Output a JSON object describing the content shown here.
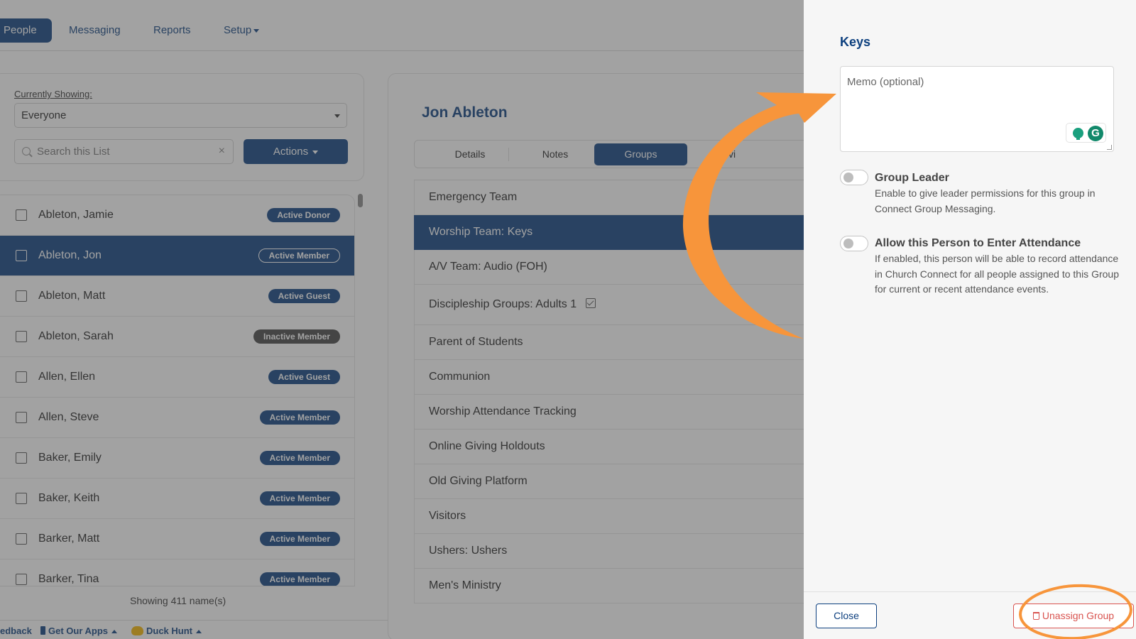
{
  "nav": {
    "people": "People",
    "messaging": "Messaging",
    "reports": "Reports",
    "setup": "Setup"
  },
  "filter": {
    "label": "Currently Showing:",
    "selected": "Everyone",
    "search_placeholder": "Search this List",
    "actions_label": "Actions"
  },
  "people": [
    {
      "name": "Ableton, Jamie",
      "status": "Active Donor"
    },
    {
      "name": "Ableton, Jon",
      "status": "Active Member"
    },
    {
      "name": "Ableton, Matt",
      "status": "Active Guest"
    },
    {
      "name": "Ableton, Sarah",
      "status": "Inactive Member"
    },
    {
      "name": "Allen, Ellen",
      "status": "Active Guest"
    },
    {
      "name": "Allen, Steve",
      "status": "Active Member"
    },
    {
      "name": "Baker, Emily",
      "status": "Active Member"
    },
    {
      "name": "Baker, Keith",
      "status": "Active Member"
    },
    {
      "name": "Barker, Matt",
      "status": "Active Member"
    },
    {
      "name": "Barker, Tina",
      "status": "Active Member"
    }
  ],
  "showing_text": "Showing 411 name(s)",
  "bottom_bar": {
    "feedback": "edback",
    "apps": "Get Our Apps",
    "duck": "Duck Hunt"
  },
  "detail": {
    "person_name": "Jon Ableton",
    "tabs": {
      "details": "Details",
      "notes": "Notes",
      "groups": "Groups",
      "giving": "Givi"
    },
    "groups": [
      "Emergency Team",
      "Worship Team: Keys",
      "A/V Team: Audio (FOH)",
      "Discipleship Groups: Adults 1",
      "Parent of Students",
      "Communion",
      "Worship Attendance Tracking",
      "Online Giving Holdouts",
      "Old Giving Platform",
      "Visitors",
      "Ushers: Ushers",
      "Men's Ministry"
    ]
  },
  "drawer": {
    "title": "Keys",
    "memo_placeholder": "Memo (optional)",
    "grammarly_letter": "G",
    "group_leader": {
      "title": "Group Leader",
      "description": "Enable to give leader permissions for this group in Connect Group Messaging.",
      "enabled": false
    },
    "attendance": {
      "title": "Allow this Person to Enter Attendance",
      "description": "If enabled, this person will be able to record attendance in Church Connect for all people assigned to this Group for current or recent attendance events.",
      "enabled": false
    },
    "close_label": "Close",
    "unassign_label": "Unassign Group"
  },
  "colors": {
    "brand": "#0c3f7e",
    "danger": "#d9534f",
    "annotation": "#f7953b"
  }
}
